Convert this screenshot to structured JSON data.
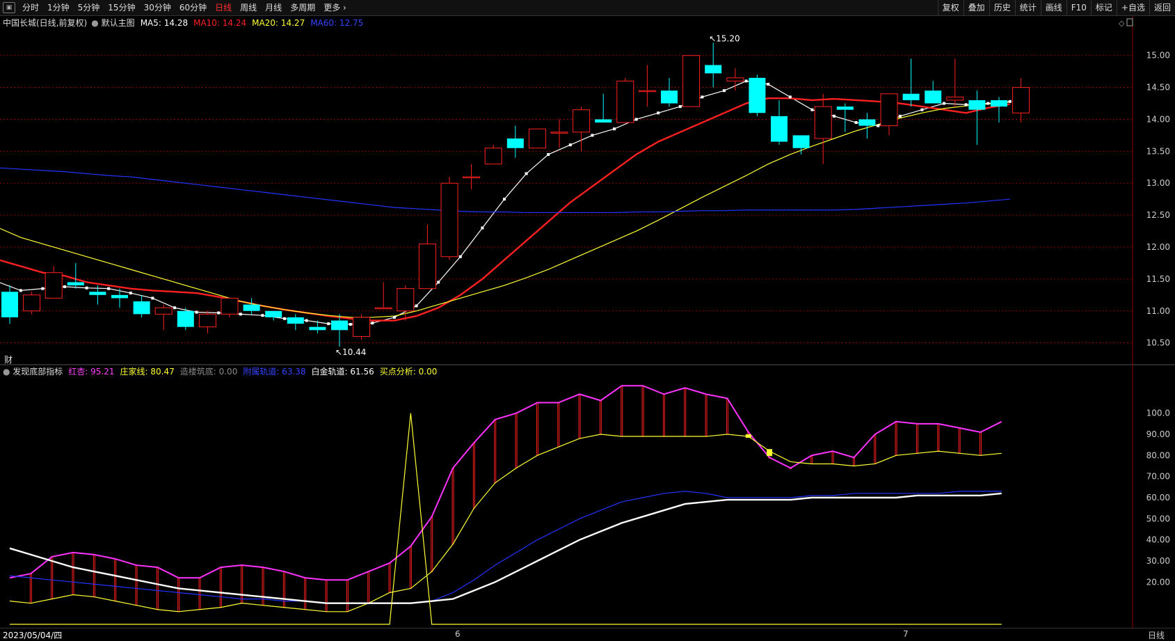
{
  "toolbar": {
    "left": [
      "分时",
      "1分钟",
      "5分钟",
      "15分钟",
      "30分钟",
      "60分钟",
      "日线",
      "周线",
      "月线",
      "多周期",
      "更多 ›"
    ],
    "active": "日线",
    "right": [
      "复权",
      "叠加",
      "历史",
      "统计",
      "画线",
      "F10",
      "标记",
      "+自选",
      "返回"
    ]
  },
  "main_legend": {
    "title": "中国长城(日线,前复权)",
    "template": "默认主图",
    "items": [
      {
        "text": "MA5: 14.28",
        "color": "#ffffff"
      },
      {
        "text": "MA10: 14.24",
        "color": "#ff2020"
      },
      {
        "text": "MA20: 14.27",
        "color": "#ffff33"
      },
      {
        "text": "MA60: 12.75",
        "color": "#3344ff"
      }
    ]
  },
  "sub_legend": {
    "title": "发现底部指标",
    "items": [
      {
        "text": "红杏: 95.21",
        "color": "#ff40ff"
      },
      {
        "text": "庄家线: 80.47",
        "color": "#ffff33"
      },
      {
        "text": "造楼筑底: 0.00",
        "color": "#888888"
      },
      {
        "text": "附属轨道: 63.38",
        "color": "#3344ff"
      },
      {
        "text": "白金轨道: 61.56",
        "color": "#ffffff"
      },
      {
        "text": "买点分析: 0.00",
        "color": "#ffff33"
      }
    ]
  },
  "cai_label": "财",
  "bottom": {
    "date": "2023/05/04/四",
    "month_labels": [
      "6",
      "7"
    ],
    "period": "日线"
  },
  "colors": {
    "up": "#ff2020",
    "down": "#00ffff",
    "ma5": "#ffffff",
    "ma10": "#ff2020",
    "ma20": "#ffff33",
    "ma60": "#2233ff",
    "magenta": "#ff33ff",
    "grid": "#8b0000"
  },
  "chart_data": [
    {
      "type": "candlestick",
      "title": "中国长城(日线,前复权)",
      "y_ticks": [
        "15.00",
        "14.50",
        "14.00",
        "13.50",
        "13.00",
        "12.50",
        "12.00",
        "11.50",
        "11.00",
        "10.50"
      ],
      "ylim": [
        10.3,
        15.4
      ],
      "high_annotation": "15.20",
      "low_annotation": "10.44",
      "ohlc": [
        [
          11.3,
          11.4,
          10.8,
          10.9
        ],
        [
          11.0,
          11.3,
          10.95,
          11.25
        ],
        [
          11.2,
          11.7,
          11.2,
          11.6
        ],
        [
          11.45,
          11.75,
          11.35,
          11.4
        ],
        [
          11.3,
          11.4,
          11.1,
          11.25
        ],
        [
          11.25,
          11.35,
          11.05,
          11.2
        ],
        [
          11.15,
          11.25,
          10.9,
          10.95
        ],
        [
          10.95,
          11.1,
          10.7,
          11.05
        ],
        [
          11.0,
          11.05,
          10.7,
          10.75
        ],
        [
          10.75,
          11.0,
          10.65,
          10.95
        ],
        [
          10.95,
          11.2,
          10.9,
          11.2
        ],
        [
          11.1,
          11.2,
          10.95,
          11.0
        ],
        [
          11.0,
          11.0,
          10.85,
          10.9
        ],
        [
          10.9,
          10.95,
          10.7,
          10.8
        ],
        [
          10.75,
          10.85,
          10.65,
          10.7
        ],
        [
          10.85,
          10.95,
          10.44,
          10.7
        ],
        [
          10.6,
          10.95,
          10.55,
          10.9
        ],
        [
          11.05,
          11.45,
          11.05,
          11.05
        ],
        [
          11.0,
          11.4,
          10.85,
          11.35
        ],
        [
          11.35,
          12.35,
          11.35,
          12.05
        ],
        [
          11.85,
          13.1,
          11.8,
          13.0
        ],
        [
          13.1,
          13.3,
          12.9,
          13.1
        ],
        [
          13.3,
          13.6,
          13.3,
          13.55
        ],
        [
          13.7,
          13.9,
          13.4,
          13.55
        ],
        [
          13.55,
          13.85,
          13.55,
          13.85
        ],
        [
          13.8,
          14.0,
          13.55,
          13.8
        ],
        [
          13.8,
          14.2,
          13.5,
          14.15
        ],
        [
          14.0,
          14.4,
          13.95,
          13.95
        ],
        [
          13.95,
          14.65,
          13.95,
          14.6
        ],
        [
          14.45,
          14.85,
          14.2,
          14.45
        ],
        [
          14.45,
          14.65,
          14.2,
          14.25
        ],
        [
          14.2,
          14.95,
          14.2,
          15.0
        ],
        [
          14.85,
          15.2,
          14.5,
          14.72
        ],
        [
          14.6,
          14.8,
          14.45,
          14.65
        ],
        [
          14.65,
          14.7,
          14.05,
          14.1
        ],
        [
          14.05,
          14.3,
          13.6,
          13.65
        ],
        [
          13.75,
          13.75,
          13.45,
          13.55
        ],
        [
          13.7,
          14.4,
          13.3,
          14.2
        ],
        [
          14.2,
          14.25,
          13.8,
          14.15
        ],
        [
          14.0,
          14.1,
          13.7,
          13.9
        ],
        [
          13.9,
          14.4,
          13.75,
          14.4
        ],
        [
          14.4,
          14.95,
          14.2,
          14.3
        ],
        [
          14.45,
          14.6,
          14.25,
          14.25
        ],
        [
          14.3,
          14.95,
          14.2,
          14.35
        ],
        [
          14.3,
          14.45,
          13.6,
          14.15
        ],
        [
          14.3,
          14.35,
          13.95,
          14.2
        ],
        [
          14.1,
          14.65,
          13.95,
          14.5
        ]
      ],
      "series": [
        {
          "name": "MA5",
          "values": [
            11.45,
            11.32,
            11.35,
            11.38,
            11.36,
            11.35,
            11.28,
            11.2,
            11.05,
            10.98,
            10.97,
            10.95,
            10.93,
            10.88,
            10.85,
            10.8,
            10.79,
            10.81,
            10.9,
            11.08,
            11.45,
            11.85,
            12.3,
            12.75,
            13.15,
            13.45,
            13.6,
            13.75,
            13.85,
            14.0,
            14.1,
            14.2,
            14.35,
            14.45,
            14.6,
            14.55,
            14.35,
            14.15,
            14.05,
            13.95,
            13.9,
            14.05,
            14.15,
            14.25,
            14.23,
            14.25,
            14.28
          ]
        },
        {
          "name": "MA10",
          "values": [
            11.8,
            11.7,
            11.6,
            11.55,
            11.45,
            11.4,
            11.35,
            11.32,
            11.3,
            11.28,
            11.22,
            11.15,
            11.08,
            11.02,
            10.97,
            10.92,
            10.88,
            10.85,
            10.85,
            10.92,
            11.05,
            11.25,
            11.5,
            11.8,
            12.1,
            12.4,
            12.7,
            12.95,
            13.2,
            13.45,
            13.65,
            13.8,
            13.95,
            14.1,
            14.25,
            14.33,
            14.33,
            14.3,
            14.32,
            14.3,
            14.28,
            14.25,
            14.2,
            14.15,
            14.1,
            14.18,
            14.24
          ]
        },
        {
          "name": "MA20",
          "values": [
            12.3,
            12.15,
            12.05,
            11.95,
            11.85,
            11.75,
            11.65,
            11.55,
            11.45,
            11.35,
            11.25,
            11.15,
            11.08,
            11.02,
            10.97,
            10.93,
            10.9,
            10.9,
            10.92,
            11.0,
            11.1,
            11.2,
            11.3,
            11.4,
            11.52,
            11.65,
            11.8,
            11.95,
            12.1,
            12.25,
            12.42,
            12.6,
            12.78,
            12.95,
            13.12,
            13.3,
            13.45,
            13.58,
            13.7,
            13.82,
            13.92,
            14.02,
            14.1,
            14.17,
            14.21,
            14.24,
            14.27
          ]
        },
        {
          "name": "MA60",
          "values": [
            13.24,
            13.22,
            13.2,
            13.18,
            13.15,
            13.12,
            13.1,
            13.06,
            13.02,
            12.98,
            12.94,
            12.9,
            12.86,
            12.82,
            12.78,
            12.74,
            12.7,
            12.66,
            12.62,
            12.6,
            12.58,
            12.56,
            12.55,
            12.55,
            12.54,
            12.54,
            12.54,
            12.54,
            12.54,
            12.55,
            12.55,
            12.56,
            12.57,
            12.57,
            12.58,
            12.58,
            12.58,
            12.58,
            12.58,
            12.59,
            12.61,
            12.63,
            12.65,
            12.67,
            12.69,
            12.72,
            12.75
          ]
        }
      ]
    },
    {
      "type": "line",
      "title": "发现底部指标",
      "y_ticks": [
        "100.0",
        "90.00",
        "80.00",
        "70.00",
        "60.00",
        "50.00",
        "40.00",
        "30.00",
        "20.00"
      ],
      "ylim": [
        0,
        120
      ],
      "series": [
        {
          "name": "红杏",
          "values": [
            22,
            24,
            32,
            34,
            33,
            31,
            28,
            27,
            22,
            22,
            27,
            28,
            27,
            25,
            22,
            21,
            21,
            25,
            29,
            37,
            51,
            74,
            86,
            97,
            100,
            105,
            105,
            109,
            106,
            113,
            113,
            109,
            112,
            109,
            107,
            91,
            79,
            74,
            80,
            82,
            79,
            90,
            96,
            95,
            95,
            93,
            91,
            96
          ]
        },
        {
          "name": "庄家线",
          "values": [
            11,
            10,
            12,
            14,
            13,
            11,
            9,
            7,
            6,
            7,
            8,
            10,
            9,
            8,
            7,
            6,
            6,
            10,
            15,
            17,
            25,
            38,
            55,
            67,
            74,
            80,
            84,
            88,
            90,
            89,
            89,
            89,
            89,
            89,
            90,
            89,
            82,
            77,
            76,
            76,
            75,
            76,
            80,
            81,
            82,
            81,
            80,
            81
          ]
        },
        {
          "name": "附属轨道",
          "values": [
            23,
            22,
            21,
            20,
            19,
            18,
            17,
            16,
            15,
            14,
            13,
            12,
            12,
            11,
            11,
            10,
            10,
            10,
            10,
            10,
            11,
            15,
            21,
            28,
            34,
            40,
            45,
            50,
            54,
            58,
            60,
            62,
            63,
            62,
            60,
            60,
            60,
            60,
            61,
            61,
            62,
            62,
            62,
            62,
            62,
            63,
            63,
            63
          ]
        },
        {
          "name": "白金轨道",
          "values": [
            36,
            33,
            30,
            27,
            25,
            23,
            21,
            19,
            17,
            16,
            15,
            14,
            13,
            12,
            11,
            10,
            10,
            10,
            10,
            10,
            11,
            12,
            16,
            20,
            25,
            30,
            35,
            40,
            44,
            48,
            51,
            54,
            57,
            58,
            59,
            59,
            59,
            59,
            60,
            60,
            60,
            60,
            60,
            61,
            61,
            61,
            61,
            62
          ]
        },
        {
          "name": "买点分析",
          "values": [
            0,
            0,
            0,
            0,
            0,
            0,
            0,
            0,
            0,
            0,
            0,
            0,
            0,
            0,
            0,
            0,
            0,
            0,
            0,
            100,
            0,
            0,
            0,
            0,
            0,
            0,
            0,
            0,
            0,
            0,
            0,
            0,
            0,
            0,
            0,
            0,
            0,
            0,
            0,
            0,
            0,
            0,
            0,
            0,
            0,
            0,
            0,
            0
          ]
        }
      ]
    }
  ]
}
